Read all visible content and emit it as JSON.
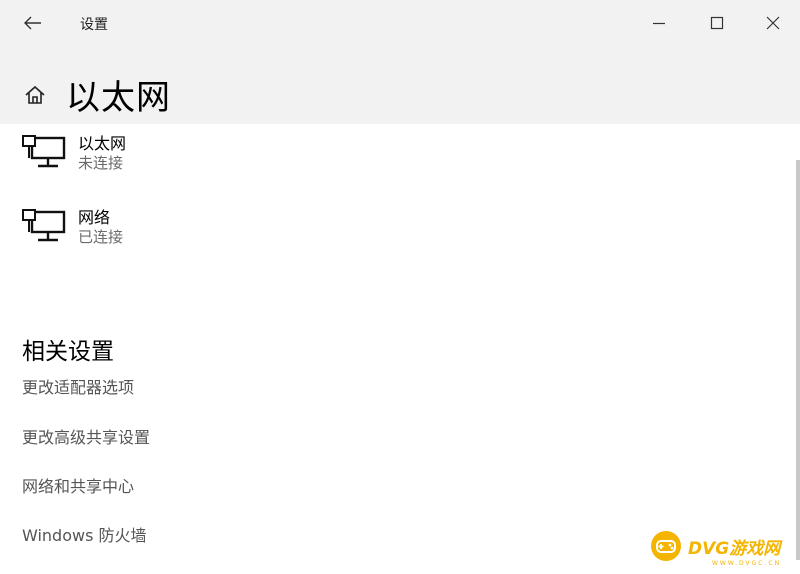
{
  "window": {
    "app_title": "设置",
    "page_title": "以太网"
  },
  "networks": [
    {
      "name": "以太网",
      "status": "未连接"
    },
    {
      "name": "网络",
      "status": "已连接"
    }
  ],
  "related": {
    "title": "相关设置",
    "links": [
      "更改适配器选项",
      "更改高级共享设置",
      "网络和共享中心",
      "Windows 防火墙"
    ]
  },
  "watermark": {
    "text": "DVG游戏网",
    "sub": "WWW.DVGC.CN",
    "color": "#f4b400"
  },
  "icons": [
    "back-arrow-icon",
    "minimize-icon",
    "maximize-icon",
    "close-icon",
    "home-icon",
    "ethernet-icon"
  ]
}
